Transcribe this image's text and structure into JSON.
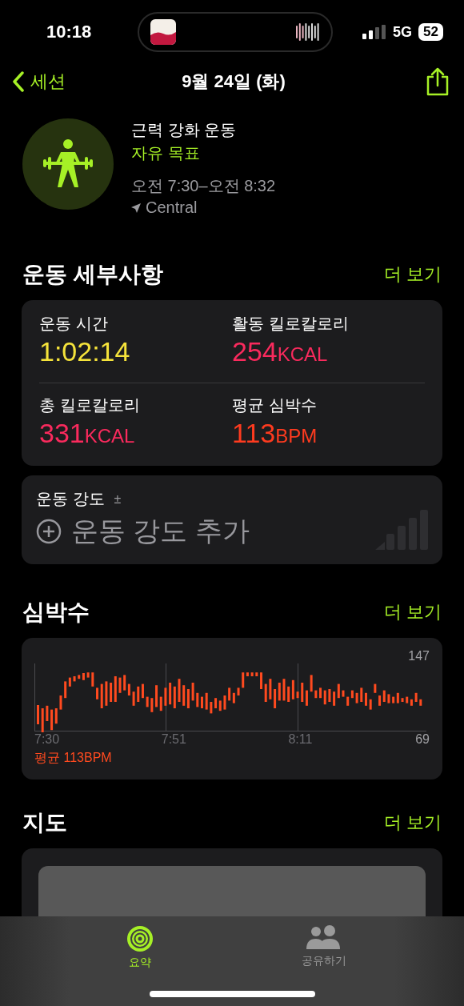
{
  "status_bar": {
    "time": "10:18",
    "network": "5G",
    "battery": "52"
  },
  "nav": {
    "back": "세션",
    "title": "9월 24일 (화)"
  },
  "workout": {
    "name": "근력 강화 운동",
    "goal": "자유 목표",
    "time_range": "오전 7:30–오전 8:32",
    "location": "Central"
  },
  "details": {
    "title": "운동 세부사항",
    "more": "더 보기",
    "metrics": [
      {
        "label": "운동 시간",
        "value": "1:02:14",
        "color": "#f5e33b"
      },
      {
        "label": "활동 킬로칼로리",
        "value": "254",
        "unit": "KCAL",
        "color": "#fa2a5d"
      },
      {
        "label": "총 킬로칼로리",
        "value": "331",
        "unit": "KCAL",
        "color": "#fa2a5d"
      },
      {
        "label": "평균 심박수",
        "value": "113",
        "unit": "BPM",
        "color": "#ff3b1f"
      }
    ]
  },
  "intensity": {
    "label": "운동 강도",
    "hint": "±",
    "add": "운동 강도 추가"
  },
  "heart_rate": {
    "title": "심박수",
    "more": "더 보기",
    "y_max": "147",
    "y_min": "69",
    "x_labels": [
      "7:30",
      "7:51",
      "8:11"
    ],
    "average": "평균 113BPM"
  },
  "map": {
    "title": "지도",
    "more": "더 보기"
  },
  "tabs": [
    {
      "label": "요약",
      "selected": true
    },
    {
      "label": "공유하기",
      "selected": false
    }
  ]
}
